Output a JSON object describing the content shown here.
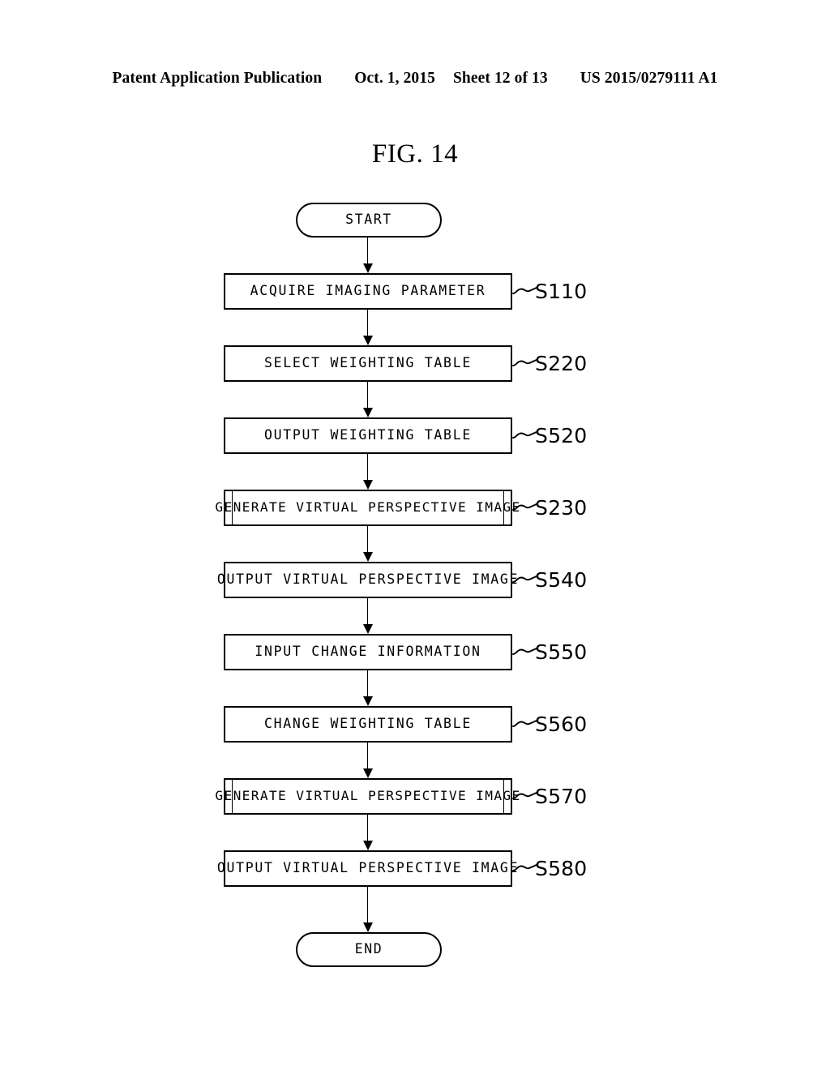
{
  "header": {
    "publication": "Patent Application Publication",
    "date": "Oct. 1, 2015",
    "sheet": "Sheet 12 of 13",
    "patent_number": "US 2015/0279111 A1"
  },
  "figure": {
    "title": "FIG. 14"
  },
  "flowchart": {
    "start_label": "START",
    "end_label": "END",
    "steps": [
      {
        "label": "ACQUIRE IMAGING PARAMETER",
        "ref": "S110",
        "shape": "process"
      },
      {
        "label": "SELECT WEIGHTING TABLE",
        "ref": "S220",
        "shape": "process"
      },
      {
        "label": "OUTPUT WEIGHTING TABLE",
        "ref": "S520",
        "shape": "process"
      },
      {
        "label": "GENERATE VIRTUAL PERSPECTIVE IMAGE",
        "ref": "S230",
        "shape": "predefined"
      },
      {
        "label": "OUTPUT VIRTUAL PERSPECTIVE IMAGE",
        "ref": "S540",
        "shape": "process"
      },
      {
        "label": "INPUT CHANGE INFORMATION",
        "ref": "S550",
        "shape": "process"
      },
      {
        "label": "CHANGE WEIGHTING TABLE",
        "ref": "S560",
        "shape": "process"
      },
      {
        "label": "GENERATE VIRTUAL PERSPECTIVE IMAGE",
        "ref": "S570",
        "shape": "predefined"
      },
      {
        "label": "OUTPUT VIRTUAL PERSPECTIVE IMAGE",
        "ref": "S580",
        "shape": "process"
      }
    ]
  },
  "colors": {
    "ink": "#000000",
    "paper": "#ffffff"
  }
}
